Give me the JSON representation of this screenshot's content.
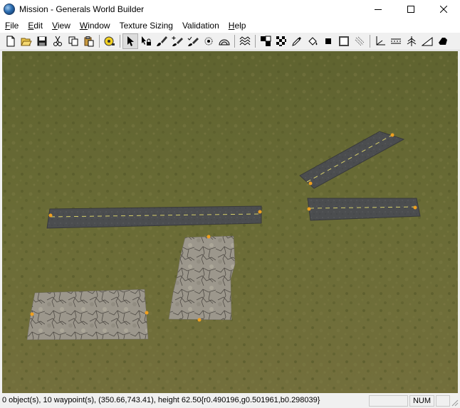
{
  "window": {
    "title": "Mission - Generals World Builder",
    "icon": "globe-icon",
    "controls": [
      "minimize-icon",
      "maximize-icon",
      "close-icon"
    ]
  },
  "menubar": {
    "items": [
      {
        "label": "File",
        "accel": "F",
        "rest": "ile"
      },
      {
        "label": "Edit",
        "accel": "E",
        "rest": "dit"
      },
      {
        "label": "View",
        "accel": "V",
        "rest": "iew"
      },
      {
        "label": "Window",
        "accel": "W",
        "rest": "indow"
      },
      {
        "label": "Texture Sizing",
        "accel": "",
        "rest": "Texture Sizing"
      },
      {
        "label": "Validation",
        "accel": "",
        "rest": "Validation"
      },
      {
        "label": "Help",
        "accel": "H",
        "rest": "elp"
      }
    ]
  },
  "toolbar": {
    "tools": [
      "new-file-icon",
      "open-folder-icon",
      "save-icon",
      "cut-icon",
      "copy-icon",
      "paste-icon",
      "separator",
      "tape-measure-icon",
      "separator",
      "pointer-icon",
      "pointer-lock-icon",
      "brush-icon",
      "brush-plus-icon",
      "brush-check-icon",
      "feather-brush-icon",
      "dome-icon",
      "separator",
      "water-waves-icon",
      "separator",
      "checker-small-icon",
      "checker-large-icon",
      "eyedropper-icon",
      "flood-fill-icon",
      "black-square-icon",
      "outline-square-icon",
      "scorch-icon",
      "separator",
      "axis-icon",
      "road-tool-icon",
      "tree-icon",
      "ramp-icon",
      "waypoint-icon"
    ],
    "active_tool": "pointer-icon"
  },
  "statusbar": {
    "main_text": "0 object(s), 10 waypoint(s), (350.66,743.41), height 62.50{r0.490196,g0.501961,b0.298039}",
    "pane_empty": "",
    "pane_num": "NUM",
    "pane_last": ""
  },
  "colors": {
    "grass": "#676a34",
    "road": "#4a4c4e",
    "road_stripe": "#d8d06a",
    "cracked_ground": "#9a948a",
    "waypoint": "#f0a020"
  }
}
